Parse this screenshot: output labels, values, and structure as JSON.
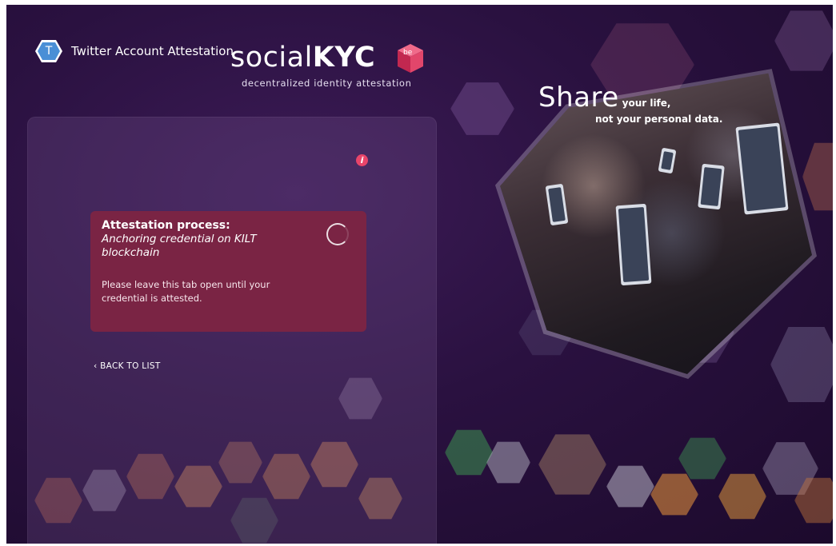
{
  "brand": {
    "name_part1": "social",
    "name_part2": "KYC",
    "cube_label": "be",
    "tagline": "decentralized identity attestation"
  },
  "panel": {
    "title": "Twitter Account Attestation",
    "badge_letter": "T",
    "info_icon": "i",
    "process": {
      "heading": "Attestation process:",
      "status": "Anchoring credential on KILT blockchain",
      "note": "Please leave this tab open until your credential is attested."
    },
    "back_link": "‹ BACK TO LIST"
  },
  "hero": {
    "headline_big": "Share",
    "headline_small": "your life,",
    "subline": "not your personal data."
  },
  "colors": {
    "background": "#2a1140",
    "process_box": "#7a2444",
    "accent_red": "#e8456a",
    "badge_blue": "#4a8fd6"
  }
}
